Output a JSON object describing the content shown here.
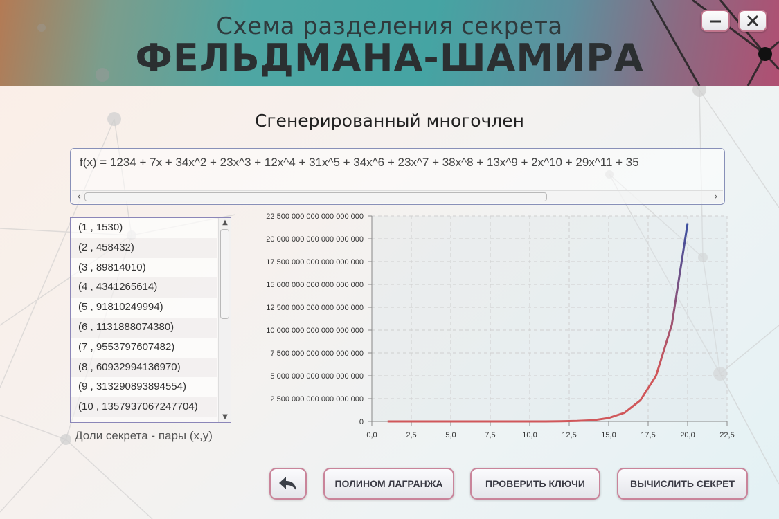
{
  "window": {
    "title_line1": "Схема разделения секрета",
    "title_line2": "ФЕЛЬДМАНА-ШАМИРА",
    "minimize_icon": "minimize-icon",
    "close_icon": "close-icon"
  },
  "section": {
    "title": "Сгенерированный многочлен"
  },
  "polynomial": {
    "text": "f(x) = 1234 + 7x + 34x^2 + 23x^3 + 12x^4 + 31x^5 + 34x^6 + 23x^7 + 38x^8 + 13x^9 + 2x^10 + 29x^11 + 35"
  },
  "shares": {
    "items": [
      "(1 , 1530)",
      "(2 , 458432)",
      "(3 , 89814010)",
      "(4 , 4341265614)",
      "(5 , 91810249994)",
      "(6 , 1131888074380)",
      "(7 , 9553797607482)",
      "(8 , 60932994136970)",
      "(9 , 313290893894554)",
      "(10 , 1357937067247704)"
    ],
    "caption": "Доли секрета - пары (x,y)"
  },
  "chart_data": {
    "type": "line",
    "x": [
      1,
      2,
      3,
      4,
      5,
      6,
      7,
      8,
      9,
      10,
      11,
      12,
      13,
      14,
      15,
      16,
      17,
      18,
      19,
      20
    ],
    "y": [
      0,
      0,
      0,
      0,
      0,
      0,
      0,
      0,
      0,
      0,
      0,
      2e+16,
      5e+16,
      1.3e+17,
      3.8e+17,
      9.5e+17,
      2.3e+18,
      5e+18,
      1.06e+19,
      2.17e+19
    ],
    "xlim": [
      0,
      22.5
    ],
    "ylim": [
      0,
      22500000000000000000
    ],
    "x_ticks": [
      "0,0",
      "2,5",
      "5,0",
      "7,5",
      "10,0",
      "12,5",
      "15,0",
      "17,5",
      "20,0",
      "22,5"
    ],
    "y_ticks": [
      "0",
      "2 500 000 000 000 000 000",
      "5 000 000 000 000 000 000",
      "7 500 000 000 000 000 000",
      "10 000 000 000 000 000 000",
      "12 500 000 000 000 000 000",
      "15 000 000 000 000 000 000",
      "17 500 000 000 000 000 000",
      "20 000 000 000 000 000 000",
      "22 500 000 000 000 000 000"
    ],
    "grid": true,
    "line_color_start": "#d0575a",
    "line_color_end": "#3a4ea0"
  },
  "buttons": {
    "back_icon": "back-arrow-icon",
    "lagrange": "ПОЛИНОМ ЛАГРАНЖА",
    "check_keys": "ПРОВЕРИТЬ КЛЮЧИ",
    "compute_secret": "ВЫЧИСЛИТЬ СЕКРЕТ"
  },
  "colors": {
    "accent_border": "#c9849a",
    "header_teal": "#45a4a3"
  }
}
